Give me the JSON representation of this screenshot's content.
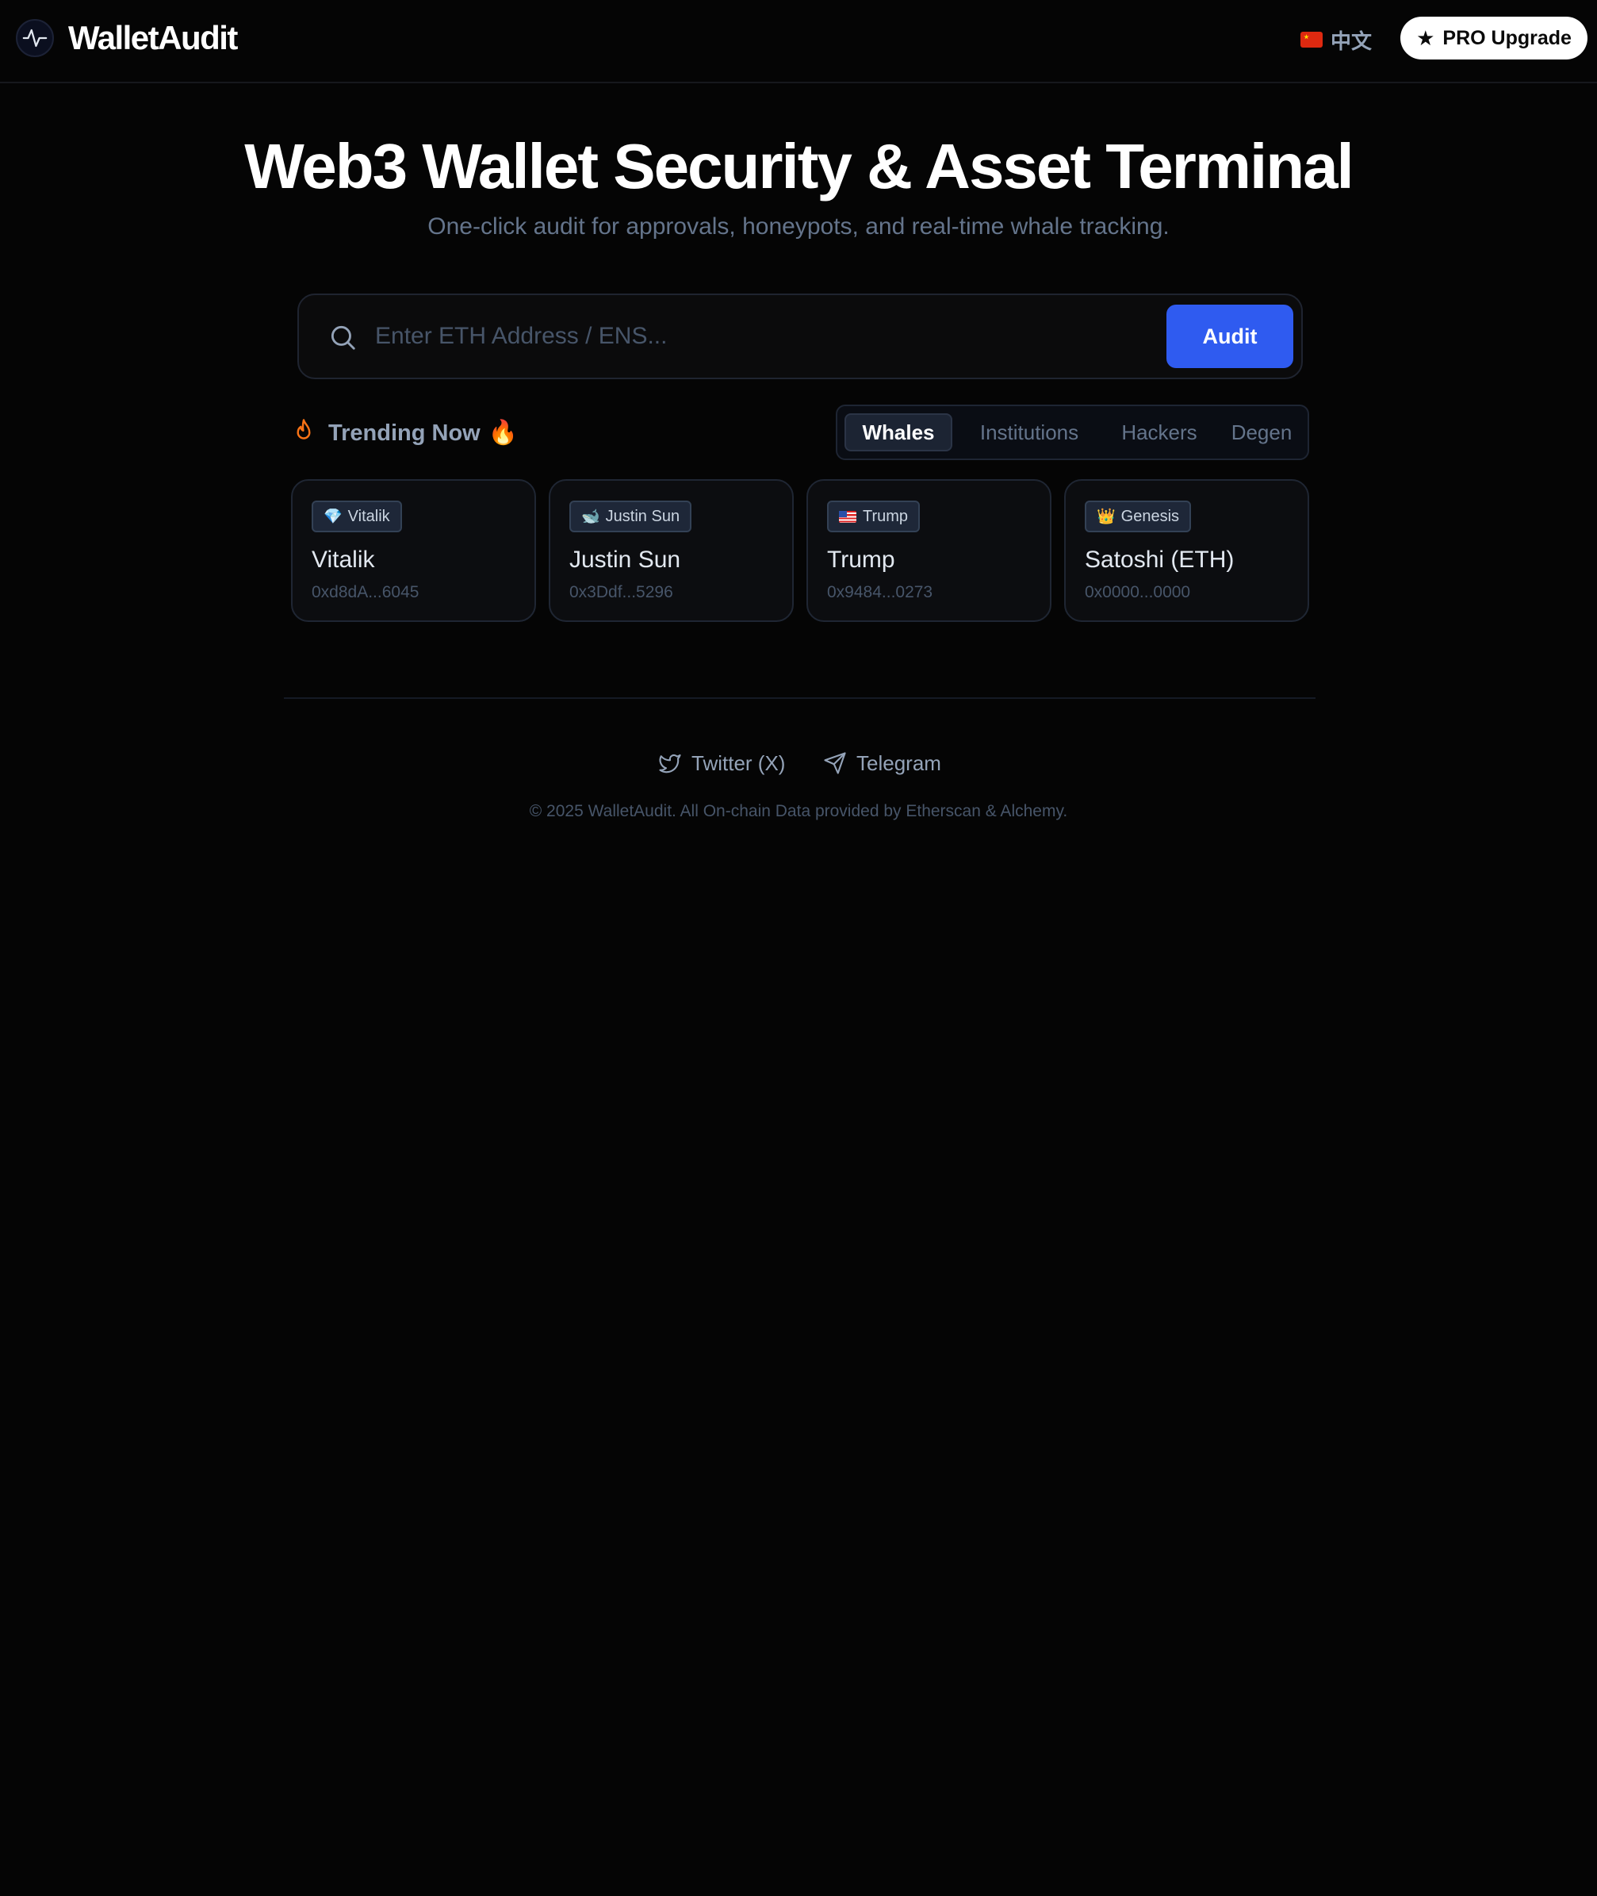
{
  "header": {
    "brand": "WalletAudit",
    "language": "中文",
    "pro_button": "PRO Upgrade"
  },
  "hero": {
    "title": "Web3 Wallet Security & Asset Terminal",
    "subtitle": "One-click audit for approvals, honeypots, and real-time whale tracking."
  },
  "search": {
    "placeholder": "Enter ETH Address / ENS...",
    "value": "",
    "button": "Audit"
  },
  "trending": {
    "label": "Trending Now",
    "emoji": "🔥",
    "tabs": [
      {
        "label": "Whales",
        "active": true
      },
      {
        "label": "Institutions",
        "active": false
      },
      {
        "label": "Hackers",
        "active": false
      },
      {
        "label": "Degen",
        "active": false
      }
    ],
    "cards": [
      {
        "chip_icon": "💎",
        "chip": "Vitalik",
        "name": "Vitalik",
        "address": "0xd8dA...6045"
      },
      {
        "chip_icon": "🐋",
        "chip": "Justin Sun",
        "name": "Justin Sun",
        "address": "0x3Ddf...5296"
      },
      {
        "chip_icon": "us-flag-icon",
        "chip": "Trump",
        "name": "Trump",
        "address": "0x9484...0273"
      },
      {
        "chip_icon": "👑",
        "chip": "Genesis",
        "name": "Satoshi (ETH)",
        "address": "0x0000...0000"
      }
    ]
  },
  "footer": {
    "twitter": "Twitter (X)",
    "telegram": "Telegram",
    "copyright": "© 2025 WalletAudit. All On-chain Data provided by Etherscan & Alchemy."
  },
  "colors": {
    "background": "#050505",
    "accent": "#2f5bf0",
    "muted_text": "#64748b",
    "flame": "#f97316"
  }
}
